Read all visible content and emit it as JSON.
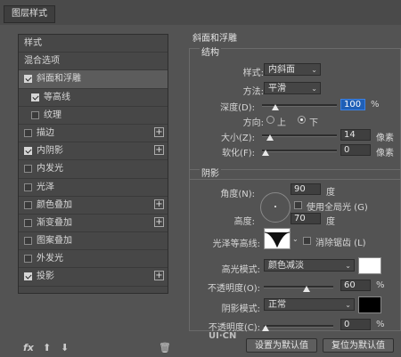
{
  "window": {
    "title": "图层样式"
  },
  "left_panel": {
    "header": "样式",
    "blend_options": "混合选项",
    "items": [
      {
        "label": "斜面和浮雕",
        "checked": true,
        "plus": false
      },
      {
        "label": "等高线",
        "checked": true,
        "plus": false
      },
      {
        "label": "纹理",
        "checked": false,
        "plus": false
      },
      {
        "label": "描边",
        "checked": false,
        "plus": true
      },
      {
        "label": "内阴影",
        "checked": true,
        "plus": true
      },
      {
        "label": "内发光",
        "checked": false,
        "plus": false
      },
      {
        "label": "光泽",
        "checked": false,
        "plus": false
      },
      {
        "label": "颜色叠加",
        "checked": false,
        "plus": true
      },
      {
        "label": "渐变叠加",
        "checked": false,
        "plus": true
      },
      {
        "label": "图案叠加",
        "checked": false,
        "plus": false
      },
      {
        "label": "外发光",
        "checked": false,
        "plus": false
      },
      {
        "label": "投影",
        "checked": true,
        "plus": true
      }
    ],
    "plus_symbol": "+",
    "bottom": {
      "fx": "fx",
      "up": "⬆",
      "down": "⬇",
      "trash": "🗑"
    }
  },
  "bevel": {
    "title": "斜面和浮雕",
    "structure_title": "结构",
    "style_label": "样式:",
    "style_value": "内斜面",
    "method_label": "方法:",
    "method_value": "平滑",
    "depth_label": "深度(D):",
    "depth_value": "100",
    "depth_unit": "%",
    "direction_label": "方向:",
    "dir_up": "上",
    "dir_down": "下",
    "size_label": "大小(Z):",
    "size_value": "14",
    "size_unit": "像素",
    "soften_label": "软化(F):",
    "soften_value": "0",
    "soften_unit": "像素",
    "shading_title": "阴影",
    "angle_label": "角度(N):",
    "angle_value": "90",
    "angle_unit": "度",
    "global_light": "使用全局光 (G)",
    "altitude_label": "高度:",
    "altitude_value": "70",
    "altitude_unit": "度",
    "gloss_label": "光泽等高线:",
    "antialias": "消除锯齿 (L)",
    "highlight_label": "高光模式:",
    "highlight_value": "颜色减淡",
    "highlight_color": "#ffffff",
    "hl_opacity_label": "不透明度(O):",
    "hl_opacity_value": "60",
    "hl_opacity_unit": "%",
    "shadow_label": "阴影模式:",
    "shadow_value": "正常",
    "shadow_color": "#000000",
    "sh_opacity_label": "不透明度(C):",
    "sh_opacity_value": "0",
    "sh_opacity_unit": "%",
    "btn_default": "设置为默认值",
    "btn_reset": "复位为默认值",
    "arrow": "⌄"
  },
  "watermark": "UI·CN"
}
